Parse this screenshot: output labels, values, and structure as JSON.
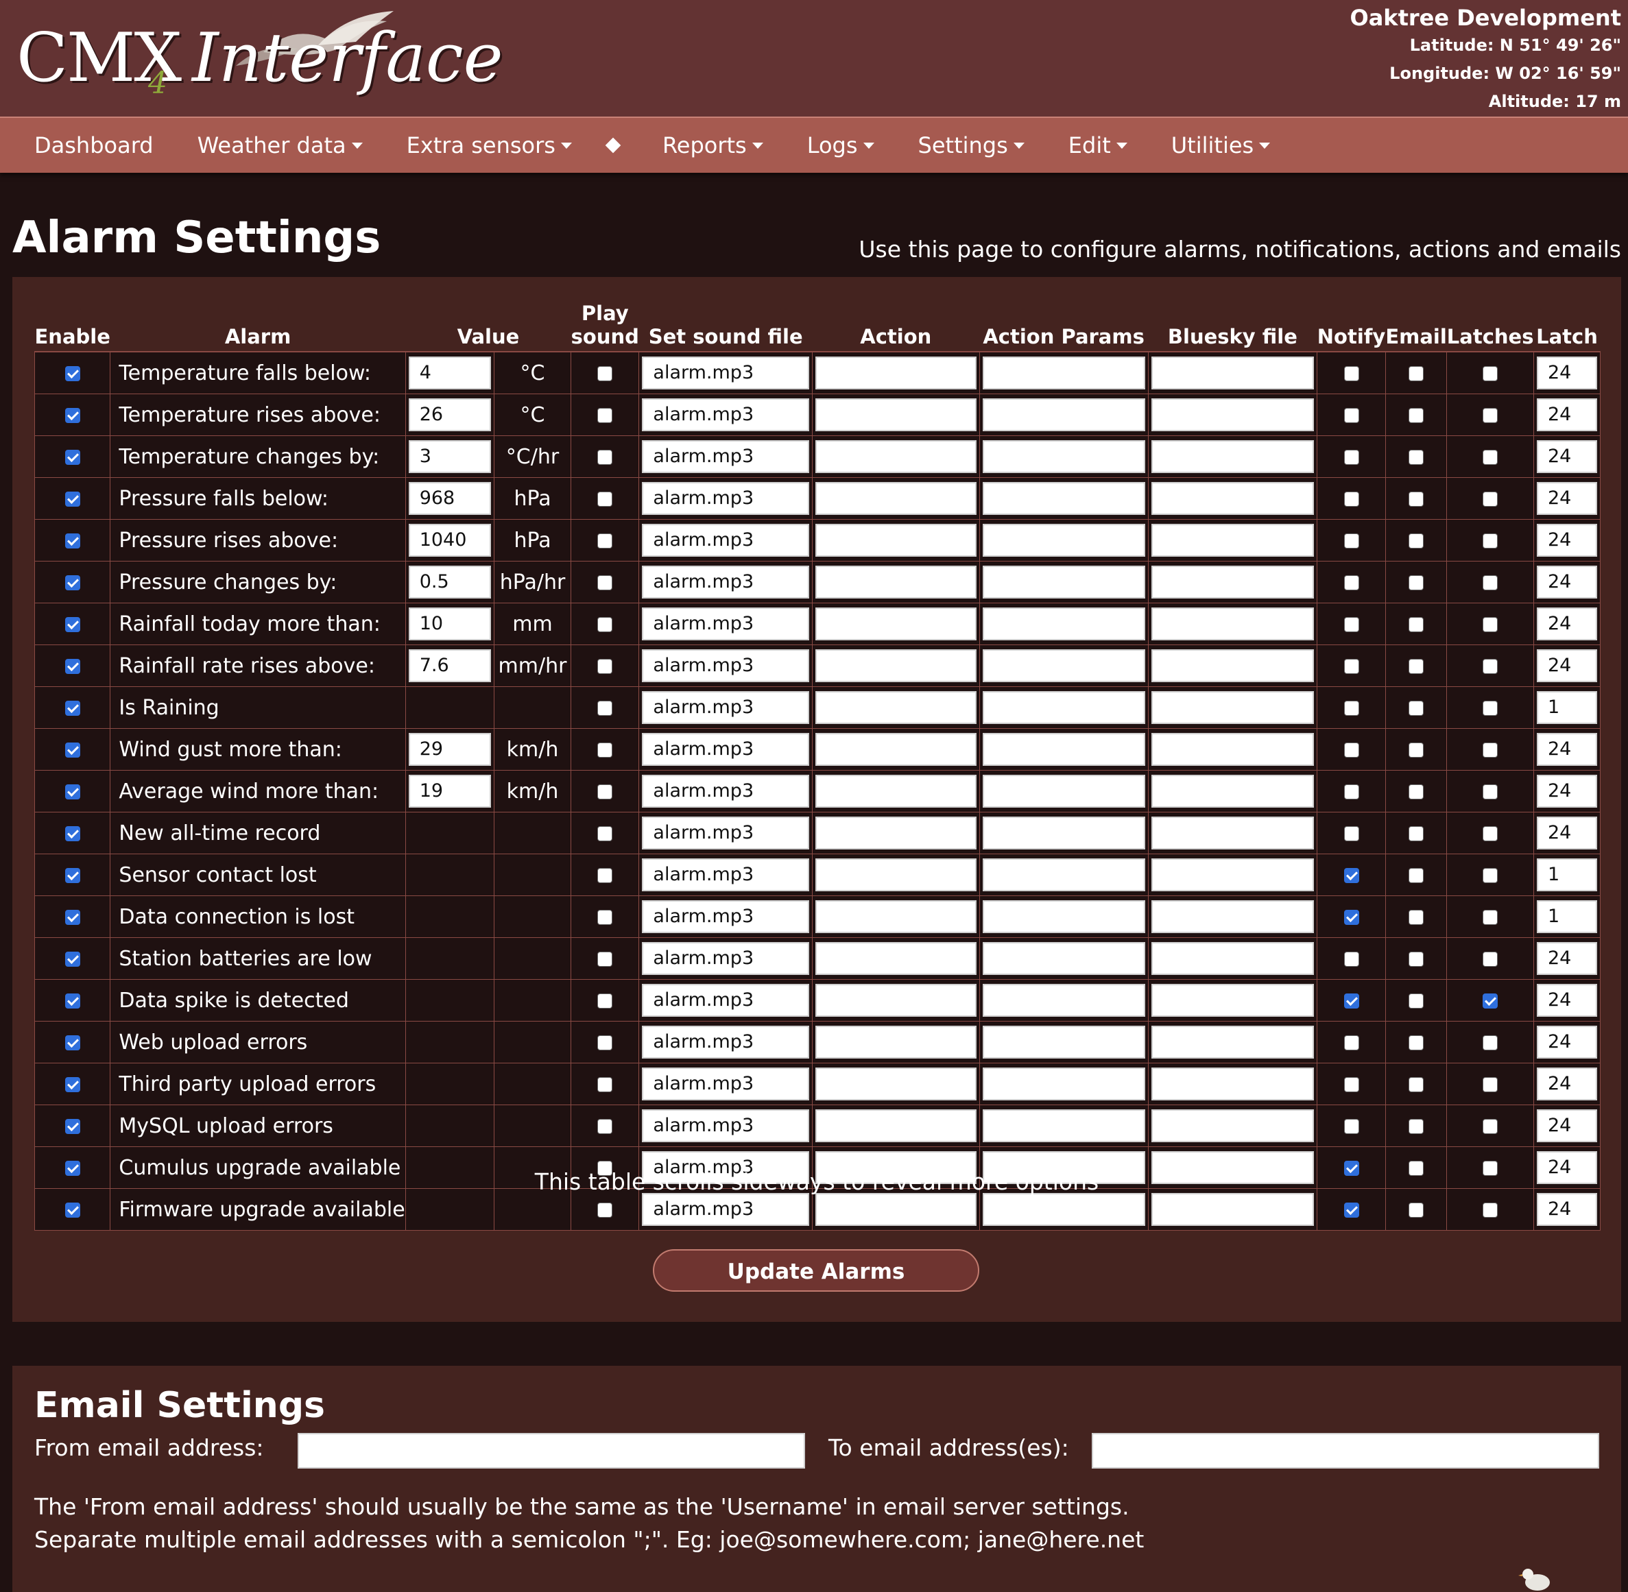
{
  "logo": {
    "cmx": "CMX",
    "four": "4",
    "interface": "Interface"
  },
  "site": {
    "name": "Oaktree Development",
    "latitude": "Latitude: N 51° 49' 26\"",
    "longitude": "Longitude: W 02° 16' 59\"",
    "altitude": "Altitude: 17 m"
  },
  "nav": [
    {
      "label": "Dashboard",
      "dropdown": false
    },
    {
      "label": "Weather data",
      "dropdown": true
    },
    {
      "label": "Extra sensors",
      "dropdown": true
    },
    {
      "label": "Reports",
      "dropdown": true
    },
    {
      "label": "Logs",
      "dropdown": true
    },
    {
      "label": "Settings",
      "dropdown": true
    },
    {
      "label": "Edit",
      "dropdown": true
    },
    {
      "label": "Utilities",
      "dropdown": true
    }
  ],
  "page": {
    "title": "Alarm Settings",
    "subtitle": "Use this page to configure alarms, notifications, actions and emails"
  },
  "table": {
    "headers": {
      "enable": "Enable",
      "alarm": "Alarm",
      "value": "Value",
      "play_sound_1": "Play",
      "play_sound_2": "sound",
      "sound_file": "Set sound file",
      "action": "Action",
      "action_params": "Action Params",
      "bluesky": "Bluesky file",
      "notify": "Notify",
      "email": "Email",
      "latches": "Latches",
      "latch": "Latch"
    },
    "rows": [
      {
        "label": "Temperature falls below:",
        "value": "4",
        "unit": "°C",
        "enable": true,
        "sound": false,
        "file": "alarm.mp3",
        "notify": false,
        "email": false,
        "latches": false,
        "latch": "24"
      },
      {
        "label": "Temperature rises above:",
        "value": "26",
        "unit": "°C",
        "enable": true,
        "sound": false,
        "file": "alarm.mp3",
        "notify": false,
        "email": false,
        "latches": false,
        "latch": "24"
      },
      {
        "label": "Temperature changes by:",
        "value": "3",
        "unit": "°C/hr",
        "enable": true,
        "sound": false,
        "file": "alarm.mp3",
        "notify": false,
        "email": false,
        "latches": false,
        "latch": "24"
      },
      {
        "label": "Pressure falls below:",
        "value": "968",
        "unit": "hPa",
        "enable": true,
        "sound": false,
        "file": "alarm.mp3",
        "notify": false,
        "email": false,
        "latches": false,
        "latch": "24"
      },
      {
        "label": "Pressure rises above:",
        "value": "1040",
        "unit": "hPa",
        "enable": true,
        "sound": false,
        "file": "alarm.mp3",
        "notify": false,
        "email": false,
        "latches": false,
        "latch": "24"
      },
      {
        "label": "Pressure changes by:",
        "value": "0.5",
        "unit": "hPa/hr",
        "enable": true,
        "sound": false,
        "file": "alarm.mp3",
        "notify": false,
        "email": false,
        "latches": false,
        "latch": "24"
      },
      {
        "label": "Rainfall today more than:",
        "value": "10",
        "unit": "mm",
        "enable": true,
        "sound": false,
        "file": "alarm.mp3",
        "notify": false,
        "email": false,
        "latches": false,
        "latch": "24"
      },
      {
        "label": "Rainfall rate rises above:",
        "value": "7.6",
        "unit": "mm/hr",
        "enable": true,
        "sound": false,
        "file": "alarm.mp3",
        "notify": false,
        "email": false,
        "latches": false,
        "latch": "24"
      },
      {
        "label": "Is Raining",
        "value": null,
        "unit": "",
        "enable": true,
        "sound": false,
        "file": "alarm.mp3",
        "notify": false,
        "email": false,
        "latches": false,
        "latch": "1"
      },
      {
        "label": "Wind gust more than:",
        "value": "29",
        "unit": "km/h",
        "enable": true,
        "sound": false,
        "file": "alarm.mp3",
        "notify": false,
        "email": false,
        "latches": false,
        "latch": "24"
      },
      {
        "label": "Average wind more than:",
        "value": "19",
        "unit": "km/h",
        "enable": true,
        "sound": false,
        "file": "alarm.mp3",
        "notify": false,
        "email": false,
        "latches": false,
        "latch": "24"
      },
      {
        "label": "New all-time record",
        "value": null,
        "unit": "",
        "enable": true,
        "sound": false,
        "file": "alarm.mp3",
        "notify": false,
        "email": false,
        "latches": false,
        "latch": "24"
      },
      {
        "label": "Sensor contact lost",
        "value": null,
        "unit": "",
        "enable": true,
        "sound": false,
        "file": "alarm.mp3",
        "notify": true,
        "email": false,
        "latches": false,
        "latch": "1"
      },
      {
        "label": "Data connection is lost",
        "value": null,
        "unit": "",
        "enable": true,
        "sound": false,
        "file": "alarm.mp3",
        "notify": true,
        "email": false,
        "latches": false,
        "latch": "1"
      },
      {
        "label": "Station batteries are low",
        "value": null,
        "unit": "",
        "enable": true,
        "sound": false,
        "file": "alarm.mp3",
        "notify": false,
        "email": false,
        "latches": false,
        "latch": "24"
      },
      {
        "label": "Data spike is detected",
        "value": null,
        "unit": "",
        "enable": true,
        "sound": false,
        "file": "alarm.mp3",
        "notify": true,
        "email": false,
        "latches": true,
        "latch": "24"
      },
      {
        "label": "Web upload errors",
        "value": null,
        "unit": "",
        "enable": true,
        "sound": false,
        "file": "alarm.mp3",
        "notify": false,
        "email": false,
        "latches": false,
        "latch": "24"
      },
      {
        "label": "Third party upload errors",
        "value": null,
        "unit": "",
        "enable": true,
        "sound": false,
        "file": "alarm.mp3",
        "notify": false,
        "email": false,
        "latches": false,
        "latch": "24"
      },
      {
        "label": "MySQL upload errors",
        "value": null,
        "unit": "",
        "enable": true,
        "sound": false,
        "file": "alarm.mp3",
        "notify": false,
        "email": false,
        "latches": false,
        "latch": "24"
      },
      {
        "label": "Cumulus upgrade available",
        "value": null,
        "unit": "",
        "enable": true,
        "sound": false,
        "file": "alarm.mp3",
        "notify": true,
        "email": false,
        "latches": false,
        "latch": "24"
      },
      {
        "label": "Firmware upgrade available",
        "value": null,
        "unit": "",
        "enable": true,
        "sound": false,
        "file": "alarm.mp3",
        "notify": true,
        "email": false,
        "latches": false,
        "latch": "24"
      }
    ]
  },
  "scroll_note": "This table scrolls sideways to reveal more options",
  "update_button": "Update Alarms",
  "email": {
    "title": "Email Settings",
    "from_label": "From email address:",
    "from_value": "",
    "to_label": "To email address(es):",
    "to_value": "",
    "note1": "The 'From email address' should usually be the same as the 'Username' in email server settings.",
    "note2": "Separate multiple email addresses with a semicolon \";\". Eg: joe@somewhere.com; jane@here.net"
  },
  "colors": {
    "header_bg": "#633333",
    "nav_bg": "#a65a50",
    "page_bg": "#1f1111",
    "panel_bg": "#44231f",
    "checkbox_on": "#2f6fdc"
  }
}
